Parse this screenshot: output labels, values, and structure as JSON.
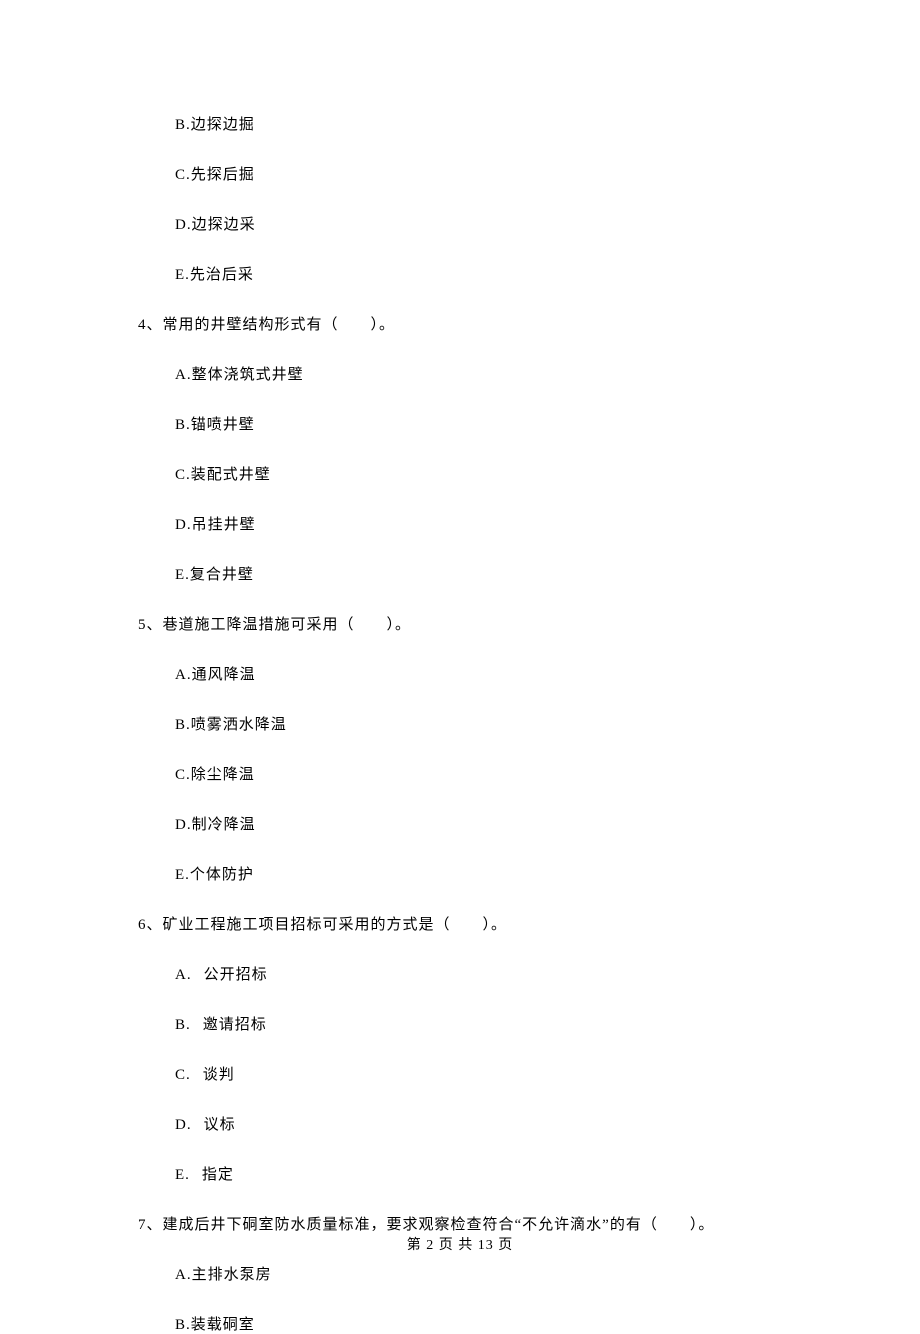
{
  "options_prev": {
    "b": "B.边探边掘",
    "c": "C.先探后掘",
    "d": "D.边探边采",
    "e": "E.先治后采"
  },
  "q4": {
    "text": "4、常用的井壁结构形式有（　　）。",
    "a": "A.整体浇筑式井壁",
    "b": "B.锚喷井壁",
    "c": "C.装配式井壁",
    "d": "D.吊挂井壁",
    "e": "E.复合井壁"
  },
  "q5": {
    "text": "5、巷道施工降温措施可采用（　　）。",
    "a": "A.通风降温",
    "b": "B.喷雾洒水降温",
    "c": "C.除尘降温",
    "d": "D.制冷降温",
    "e": "E.个体防护"
  },
  "q6": {
    "text": "6、矿业工程施工项目招标可采用的方式是（　　）。",
    "a_letter": "A.",
    "a_text": "公开招标",
    "b_letter": "B.",
    "b_text": "邀请招标",
    "c_letter": "C.",
    "c_text": "谈判",
    "d_letter": "D.",
    "d_text": "议标",
    "e_letter": "E.",
    "e_text": "指定"
  },
  "q7": {
    "text": "7、建成后井下硐室防水质量标准，要求观察检查符合“不允许滴水”的有（　　）。",
    "a": "A.主排水泵房",
    "b": "B.装载硐室"
  },
  "footer": "第 2 页 共 13 页"
}
